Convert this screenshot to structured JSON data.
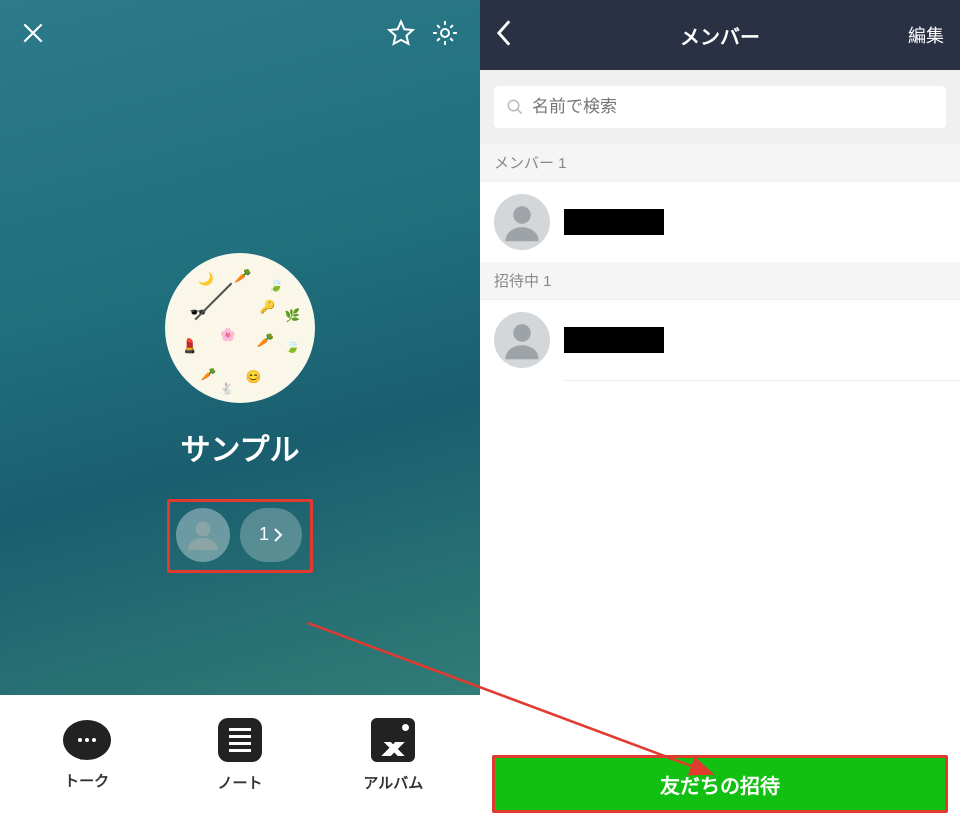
{
  "left": {
    "group_name": "サンプル",
    "member_count": "1",
    "actions": {
      "talk": "トーク",
      "note": "ノート",
      "album": "アルバム"
    }
  },
  "right": {
    "nav": {
      "title": "メンバー",
      "edit": "編集"
    },
    "search": {
      "placeholder": "名前で検索"
    },
    "sections": {
      "members_header": "メンバー 1",
      "pending_header": "招待中 1"
    },
    "invite_button": "友だちの招待"
  }
}
